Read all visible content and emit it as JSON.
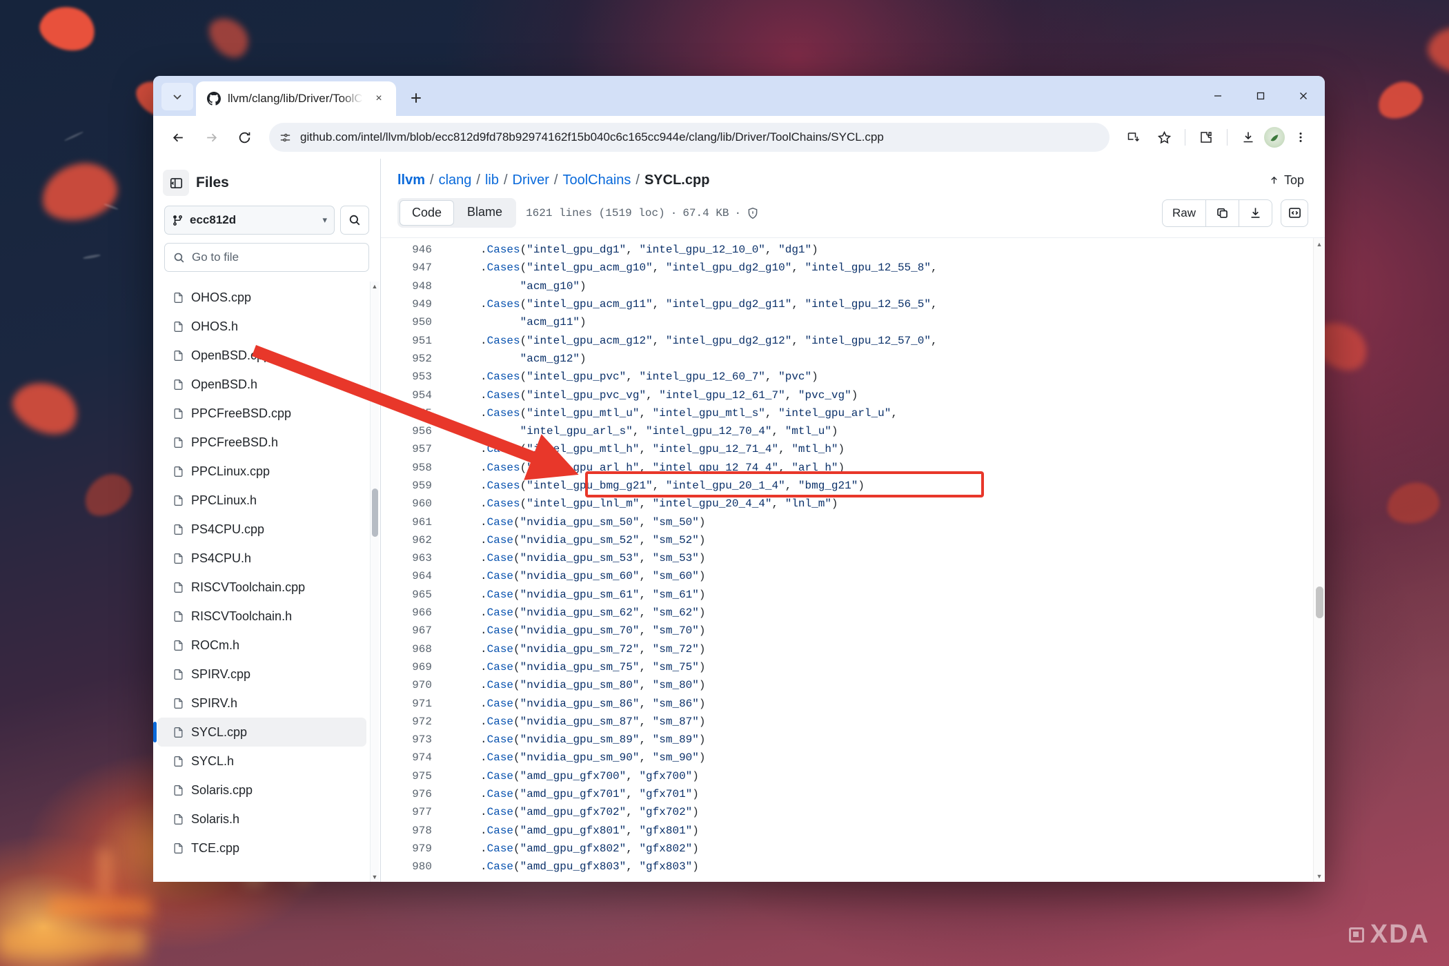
{
  "browser": {
    "tab": {
      "title": "llvm/clang/lib/Driver/ToolChains/SYCL.cpp",
      "favicon": "github-icon",
      "close_label": "×"
    },
    "new_tab_label": "+",
    "tab_search_icon": "chevron-down-icon",
    "window_controls": {
      "minimize": "–",
      "maximize": "□",
      "close": "✕"
    },
    "nav": {
      "back": "←",
      "forward": "→",
      "reload": "↻"
    },
    "omnibox": {
      "url": "github.com/intel/llvm/blob/ecc812d9fd78b92974162f15b040c6c165cc944e/clang/lib/Driver/ToolChains/SYCL.cpp",
      "site_settings_icon": "tune-icon"
    },
    "toolbar_icons": [
      "install-app-icon",
      "bookmark-star-icon",
      "extensions-icon",
      "downloads-icon",
      "profile-avatar",
      "chrome-menu-icon"
    ]
  },
  "sidebar": {
    "heading": "Files",
    "toggle_icon": "sidebar-collapse-icon",
    "branch": {
      "name": "ecc812d",
      "icon": "branch-icon",
      "caret": "▾"
    },
    "search_icon": "search-icon",
    "goto_file": {
      "placeholder": "Go to file",
      "value": "",
      "icon": "search-icon"
    },
    "files": [
      {
        "name": "OHOS.cpp",
        "selected": false
      },
      {
        "name": "OHOS.h",
        "selected": false
      },
      {
        "name": "OpenBSD.cpp",
        "selected": false
      },
      {
        "name": "OpenBSD.h",
        "selected": false
      },
      {
        "name": "PPCFreeBSD.cpp",
        "selected": false
      },
      {
        "name": "PPCFreeBSD.h",
        "selected": false
      },
      {
        "name": "PPCLinux.cpp",
        "selected": false
      },
      {
        "name": "PPCLinux.h",
        "selected": false
      },
      {
        "name": "PS4CPU.cpp",
        "selected": false
      },
      {
        "name": "PS4CPU.h",
        "selected": false
      },
      {
        "name": "RISCVToolchain.cpp",
        "selected": false
      },
      {
        "name": "RISCVToolchain.h",
        "selected": false
      },
      {
        "name": "ROCm.h",
        "selected": false
      },
      {
        "name": "SPIRV.cpp",
        "selected": false
      },
      {
        "name": "SPIRV.h",
        "selected": false
      },
      {
        "name": "SYCL.cpp",
        "selected": true
      },
      {
        "name": "SYCL.h",
        "selected": false
      },
      {
        "name": "Solaris.cpp",
        "selected": false
      },
      {
        "name": "Solaris.h",
        "selected": false
      },
      {
        "name": "TCE.cpp",
        "selected": false
      }
    ]
  },
  "content": {
    "breadcrumb": {
      "repo": "llvm",
      "parts": [
        "clang",
        "lib",
        "Driver",
        "ToolChains"
      ],
      "current": "SYCL.cpp",
      "separator": "/"
    },
    "top_link": {
      "label": "Top",
      "icon": "arrow-up-icon"
    },
    "view_tabs": [
      {
        "label": "Code",
        "active": true
      },
      {
        "label": "Blame",
        "active": false
      }
    ],
    "file_meta": {
      "lines": "1621 lines (1519 loc)",
      "dot": "·",
      "size": "67.4 KB",
      "security_icon": "shield-icon"
    },
    "actions": {
      "raw": "Raw",
      "copy_icon": "copy-icon",
      "download_icon": "download-icon",
      "symbols_icon": "code-brackets-icon"
    },
    "code_lines": [
      {
        "n": "946",
        "text": ".Cases(\"intel_gpu_dg1\", \"intel_gpu_12_10_0\", \"dg1\")",
        "indent": 0
      },
      {
        "n": "947",
        "text": ".Cases(\"intel_gpu_acm_g10\", \"intel_gpu_dg2_g10\", \"intel_gpu_12_55_8\",",
        "indent": 0
      },
      {
        "n": "948",
        "text": "      \"acm_g10\")",
        "indent": 0
      },
      {
        "n": "949",
        "text": ".Cases(\"intel_gpu_acm_g11\", \"intel_gpu_dg2_g11\", \"intel_gpu_12_56_5\",",
        "indent": 0
      },
      {
        "n": "950",
        "text": "      \"acm_g11\")",
        "indent": 0
      },
      {
        "n": "951",
        "text": ".Cases(\"intel_gpu_acm_g12\", \"intel_gpu_dg2_g12\", \"intel_gpu_12_57_0\",",
        "indent": 0
      },
      {
        "n": "952",
        "text": "      \"acm_g12\")",
        "indent": 0
      },
      {
        "n": "953",
        "text": ".Cases(\"intel_gpu_pvc\", \"intel_gpu_12_60_7\", \"pvc\")",
        "indent": 0
      },
      {
        "n": "954",
        "text": ".Cases(\"intel_gpu_pvc_vg\", \"intel_gpu_12_61_7\", \"pvc_vg\")",
        "indent": 0
      },
      {
        "n": "955",
        "text": ".Cases(\"intel_gpu_mtl_u\", \"intel_gpu_mtl_s\", \"intel_gpu_arl_u\",",
        "indent": 0
      },
      {
        "n": "956",
        "text": "      \"intel_gpu_arl_s\", \"intel_gpu_12_70_4\", \"mtl_u\")",
        "indent": 0
      },
      {
        "n": "957",
        "text": ".Cases(\"intel_gpu_mtl_h\", \"intel_gpu_12_71_4\", \"mtl_h\")",
        "indent": 0
      },
      {
        "n": "958",
        "text": ".Cases(\"intel_gpu_arl_h\", \"intel_gpu_12_74_4\", \"arl_h\")",
        "indent": 0
      },
      {
        "n": "959",
        "text": ".Cases(\"intel_gpu_bmg_g21\", \"intel_gpu_20_1_4\", \"bmg_g21\")",
        "indent": 0,
        "highlighted": true
      },
      {
        "n": "960",
        "text": ".Cases(\"intel_gpu_lnl_m\", \"intel_gpu_20_4_4\", \"lnl_m\")",
        "indent": 0
      },
      {
        "n": "961",
        "text": ".Case(\"nvidia_gpu_sm_50\", \"sm_50\")",
        "indent": 0
      },
      {
        "n": "962",
        "text": ".Case(\"nvidia_gpu_sm_52\", \"sm_52\")",
        "indent": 0
      },
      {
        "n": "963",
        "text": ".Case(\"nvidia_gpu_sm_53\", \"sm_53\")",
        "indent": 0
      },
      {
        "n": "964",
        "text": ".Case(\"nvidia_gpu_sm_60\", \"sm_60\")",
        "indent": 0
      },
      {
        "n": "965",
        "text": ".Case(\"nvidia_gpu_sm_61\", \"sm_61\")",
        "indent": 0
      },
      {
        "n": "966",
        "text": ".Case(\"nvidia_gpu_sm_62\", \"sm_62\")",
        "indent": 0
      },
      {
        "n": "967",
        "text": ".Case(\"nvidia_gpu_sm_70\", \"sm_70\")",
        "indent": 0
      },
      {
        "n": "968",
        "text": ".Case(\"nvidia_gpu_sm_72\", \"sm_72\")",
        "indent": 0
      },
      {
        "n": "969",
        "text": ".Case(\"nvidia_gpu_sm_75\", \"sm_75\")",
        "indent": 0
      },
      {
        "n": "970",
        "text": ".Case(\"nvidia_gpu_sm_80\", \"sm_80\")",
        "indent": 0
      },
      {
        "n": "971",
        "text": ".Case(\"nvidia_gpu_sm_86\", \"sm_86\")",
        "indent": 0
      },
      {
        "n": "972",
        "text": ".Case(\"nvidia_gpu_sm_87\", \"sm_87\")",
        "indent": 0
      },
      {
        "n": "973",
        "text": ".Case(\"nvidia_gpu_sm_89\", \"sm_89\")",
        "indent": 0
      },
      {
        "n": "974",
        "text": ".Case(\"nvidia_gpu_sm_90\", \"sm_90\")",
        "indent": 0
      },
      {
        "n": "975",
        "text": ".Case(\"amd_gpu_gfx700\", \"gfx700\")",
        "indent": 0
      },
      {
        "n": "976",
        "text": ".Case(\"amd_gpu_gfx701\", \"gfx701\")",
        "indent": 0
      },
      {
        "n": "977",
        "text": ".Case(\"amd_gpu_gfx702\", \"gfx702\")",
        "indent": 0
      },
      {
        "n": "978",
        "text": ".Case(\"amd_gpu_gfx801\", \"gfx801\")",
        "indent": 0
      },
      {
        "n": "979",
        "text": ".Case(\"amd_gpu_gfx802\", \"gfx802\")",
        "indent": 0
      },
      {
        "n": "980",
        "text": ".Case(\"amd_gpu_gfx803\", \"gfx803\")",
        "indent": 0
      }
    ]
  },
  "annotation": {
    "highlight_line": "959",
    "highlight_color": "#e8372a",
    "arrow_color": "#e8372a"
  },
  "watermark": {
    "text": "XDA"
  },
  "colors": {
    "accent_blue": "#0969da",
    "code_string": "#0a3069",
    "code_fn": "#0550ae",
    "annotation_red": "#e8372a"
  }
}
